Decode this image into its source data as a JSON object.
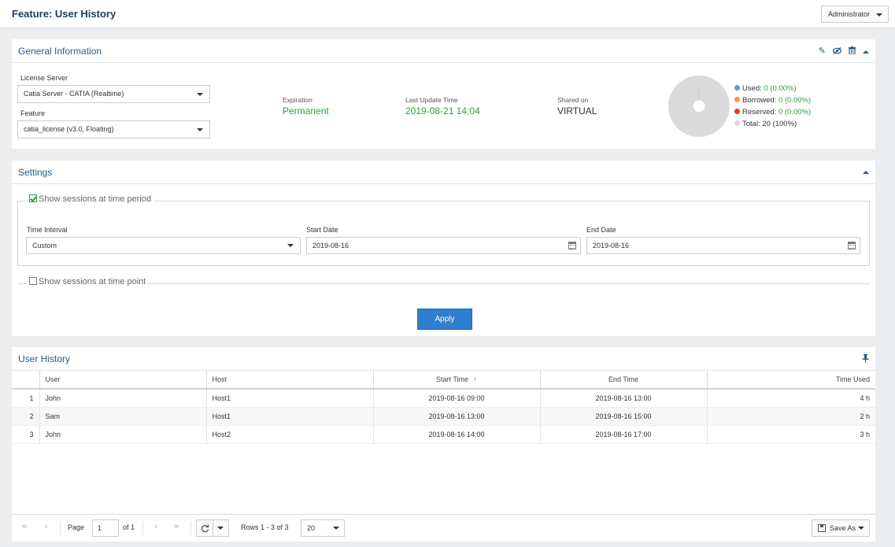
{
  "header": {
    "title": "Feature: User History",
    "user_menu": "Administrator"
  },
  "general": {
    "title": "General Information",
    "license_server_label": "License Server",
    "license_server_value": "Catia Server - CATIA (Realtime)",
    "feature_label": "Feature",
    "feature_value": "catia_license (v3.0, Floating)",
    "expiration_label": "Expiration",
    "expiration_value": "Permanent",
    "last_update_label": "Last Update Time",
    "last_update_value": "2019-08-21 14:04",
    "shared_label": "Shared on",
    "shared_value": "VIRTUAL",
    "usage": {
      "used_label": "Used:",
      "used_value": "0 (0.00%)",
      "used_color": "#5b9bd5",
      "borrowed_label": "Borrowed:",
      "borrowed_value": "0 (0.00%)",
      "borrowed_color": "#f2994a",
      "reserved_label": "Reserved:",
      "reserved_value": "0 (0.00%)",
      "reserved_color": "#e0392b",
      "total_label": "Total:",
      "total_value": "20 (100%)",
      "total_color": "#d9d9d9"
    }
  },
  "settings": {
    "title": "Settings",
    "period_label": "Show sessions at time period",
    "period_checked": true,
    "time_interval_label": "Time Interval",
    "time_interval_value": "Custom",
    "start_date_label": "Start Date",
    "start_date_value": "2019-08-16",
    "end_date_label": "End Date",
    "end_date_value": "2019-08-16",
    "point_label": "Show sessions at time point",
    "point_checked": false,
    "apply_label": "Apply"
  },
  "history": {
    "title": "User History",
    "columns": [
      "User",
      "Host",
      "Start Time",
      "End Time",
      "Time Used"
    ],
    "sort_indicator": "↑",
    "rows": [
      {
        "n": "1",
        "user": "John",
        "host": "Host1",
        "start": "2019-08-16 09:00",
        "end": "2019-08-16 13:00",
        "used": "4 h"
      },
      {
        "n": "2",
        "user": "Sam",
        "host": "Host1",
        "start": "2019-08-16 13:00",
        "end": "2019-08-16 15:00",
        "used": "2 h"
      },
      {
        "n": "3",
        "user": "John",
        "host": "Host2",
        "start": "2019-08-16 14:00",
        "end": "2019-08-16 17:00",
        "used": "3 h"
      }
    ]
  },
  "pager": {
    "first": "«",
    "prev": "‹",
    "next": "›",
    "last": "»",
    "page_label": "Page",
    "page_value": "1",
    "of_label": "of 1",
    "rows_info": "Rows 1 - 3 of 3",
    "page_size": "20",
    "save_as": "Save As"
  }
}
